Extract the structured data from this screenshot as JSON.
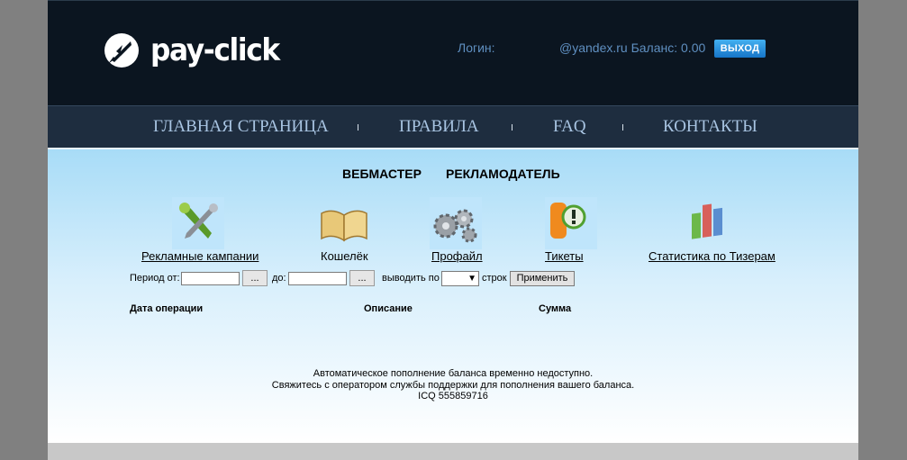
{
  "header": {
    "logo_text": "pay-click",
    "login_label": "Логин:",
    "account_text": "@yandex.ru Баланс: 0.00",
    "logout_label": "ВЫХОД"
  },
  "nav": {
    "items": [
      {
        "label": "ГЛАВНАЯ СТРАНИЦА"
      },
      {
        "label": "ПРАВИЛА"
      },
      {
        "label": "FAQ"
      },
      {
        "label": "КОНТАКТЫ"
      }
    ]
  },
  "roles": {
    "webmaster": "ВЕБМАСТЕР",
    "advertiser": "РЕКЛАМОДАТЕЛЬ"
  },
  "menu": {
    "items": [
      {
        "label": "Рекламные кампании",
        "icon": "tools-icon"
      },
      {
        "label": "Кошелёк",
        "icon": "book-icon"
      },
      {
        "label": "Профайл",
        "icon": "gears-icon"
      },
      {
        "label": "Тикеты",
        "icon": "ticket-icon"
      },
      {
        "label": "Статистика по Тизерам",
        "icon": "bar-chart-icon"
      }
    ]
  },
  "filter": {
    "period_from_label": "Период от:",
    "to_label": "до:",
    "show_by_label": "выводить по",
    "rows_label": "строк",
    "dots_label": "...",
    "apply_label": "Применить",
    "date_from_value": "",
    "date_to_value": "",
    "rows_value": ""
  },
  "table": {
    "columns": [
      "Дата операции",
      "Описание",
      "Сумма"
    ]
  },
  "notice": {
    "line1": "Автоматическое пополнение баланса временно недоступно.",
    "line2": "Свяжитесь с оператором службы поддержки для пополнения вашего баланса.",
    "line3": "ICQ 555859716"
  },
  "colors": {
    "header_bg": "#0b1520",
    "nav_bg": "#1e2d3f",
    "nav_text": "#a8c4e2",
    "account_text": "#5f8fc0",
    "logout_bg": "#1e8ee0",
    "content_top": "#a8dcf7",
    "page_bg": "#808080"
  }
}
